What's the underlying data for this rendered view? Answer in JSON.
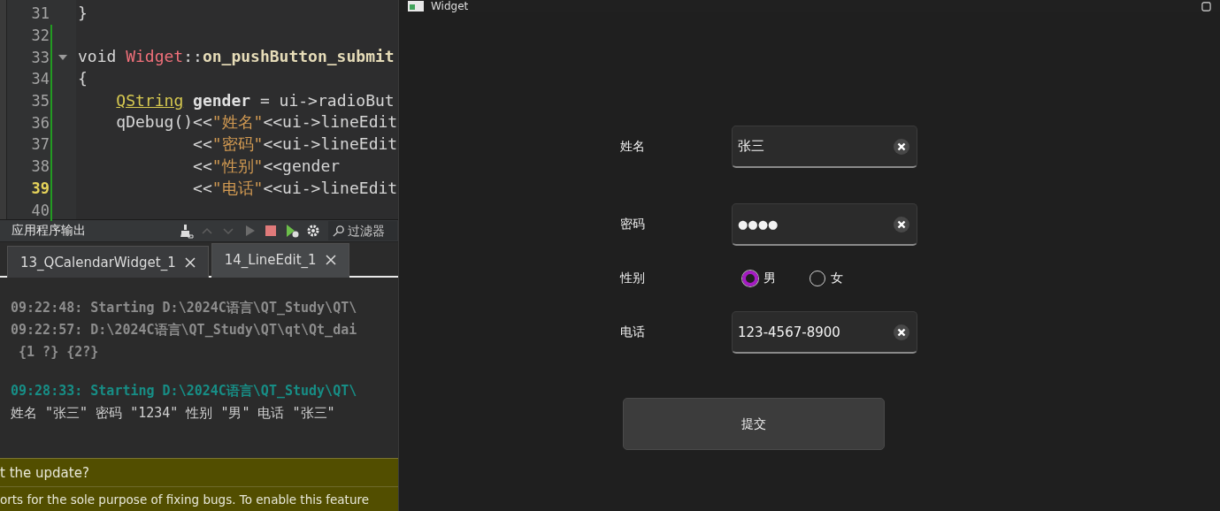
{
  "editor": {
    "lines": [
      {
        "number": "31",
        "current": false,
        "foldable": false,
        "modified": false,
        "segments": [
          {
            "text": "}",
            "kind": "plain"
          }
        ]
      },
      {
        "number": "32",
        "current": false,
        "foldable": false,
        "modified": true
      },
      {
        "number": "33",
        "current": false,
        "foldable": true,
        "modified": true,
        "segments": [
          {
            "text": "void ",
            "kind": "keyword"
          },
          {
            "text": "Widget",
            "kind": "class"
          },
          {
            "text": "::",
            "kind": "plain"
          },
          {
            "text": "on_pushButton_submit",
            "kind": "function"
          }
        ]
      },
      {
        "number": "34",
        "current": false,
        "foldable": false,
        "modified": true,
        "segments": [
          {
            "text": "{",
            "kind": "plain"
          }
        ]
      },
      {
        "number": "35",
        "current": false,
        "foldable": false,
        "modified": true,
        "segments": [
          {
            "text": "    QString",
            "kind": "type"
          },
          {
            "text": " gender",
            "kind": "local"
          },
          {
            "text": " = ui->radioBut",
            "kind": "plain"
          }
        ]
      },
      {
        "number": "36",
        "current": false,
        "foldable": false,
        "modified": true,
        "segments": [
          {
            "text": "    qDebug()<<",
            "kind": "plain"
          },
          {
            "text": "\"姓名\"",
            "kind": "string"
          },
          {
            "text": "<<ui->lineEdit",
            "kind": "plain"
          }
        ]
      },
      {
        "number": "37",
        "current": false,
        "foldable": false,
        "modified": true,
        "segments": [
          {
            "text": "            <<",
            "kind": "plain"
          },
          {
            "text": "\"密码\"",
            "kind": "string"
          },
          {
            "text": "<<ui->lineEdit",
            "kind": "plain"
          }
        ]
      },
      {
        "number": "38",
        "current": false,
        "foldable": false,
        "modified": true,
        "segments": [
          {
            "text": "            <<",
            "kind": "plain"
          },
          {
            "text": "\"性别\"",
            "kind": "string"
          },
          {
            "text": "<<gender",
            "kind": "plain"
          }
        ]
      },
      {
        "number": "39",
        "current": true,
        "foldable": false,
        "modified": true,
        "segments": [
          {
            "text": "            <<",
            "kind": "plain"
          },
          {
            "text": "\"电话\"",
            "kind": "string"
          },
          {
            "text": "<<ui->lineEdit",
            "kind": "plain"
          }
        ]
      },
      {
        "number": "40",
        "current": false,
        "foldable": false,
        "modified": true
      }
    ]
  },
  "output": {
    "title": "应用程序输出",
    "filter": {
      "placeholder": "过滤器"
    },
    "tabs": [
      {
        "label": "13_QCalendarWidget_1",
        "selected": false
      },
      {
        "label": "14_LineEdit_1",
        "selected": true
      }
    ],
    "lines": [
      {
        "kind": "log",
        "text": "09:22:48: Starting D:\\2024C语言\\QT_Study\\QT\\"
      },
      {
        "kind": "log",
        "text": "09:22:57: D:\\2024C语言\\QT_Study\\QT\\qt\\Qt_dai"
      },
      {
        "kind": "log",
        "text": " {1 ?} {2?}"
      },
      {
        "kind": "start",
        "text": "09:28:33: Starting D:\\2024C语言\\QT_Study\\QT\\"
      },
      {
        "kind": "plain",
        "text": "姓名 \"张三\" 密码 \"1234\" 性别 \"男\" 电话 \"张三\""
      }
    ]
  },
  "notification": {
    "question": "t the update?",
    "message": "orts for the sole purpose of fixing bugs. To enable this feature"
  },
  "window": {
    "title": "Widget",
    "rows": [
      {
        "kind": "text",
        "label": "姓名",
        "value": "张三"
      },
      {
        "kind": "password",
        "label": "密码",
        "value": "●●●●"
      },
      {
        "kind": "radio",
        "label": "性别",
        "options": [
          {
            "label": "男",
            "selected": true
          },
          {
            "label": "女",
            "selected": false
          }
        ]
      },
      {
        "kind": "text",
        "label": "电话",
        "value": "123-4567-8900"
      }
    ],
    "submit": "提交"
  }
}
